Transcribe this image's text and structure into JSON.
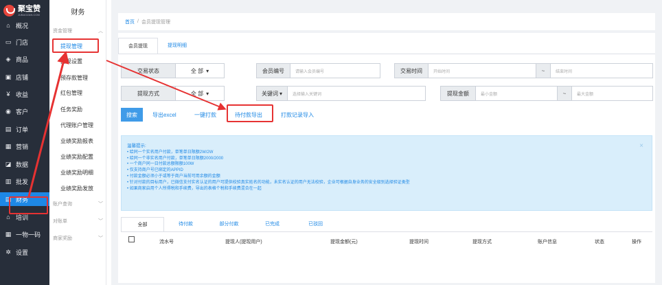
{
  "logo": {
    "name": "聚宝赞",
    "sub": "JUBAOZAN.COM"
  },
  "nav": [
    {
      "label": "概况",
      "icon": "home-icon"
    },
    {
      "label": "门店",
      "icon": "store-icon"
    },
    {
      "label": "商品",
      "icon": "tag-icon"
    },
    {
      "label": "店铺",
      "icon": "shop-icon"
    },
    {
      "label": "收益",
      "icon": "coin-icon"
    },
    {
      "label": "客户",
      "icon": "user-icon"
    },
    {
      "label": "订单",
      "icon": "order-icon"
    },
    {
      "label": "营销",
      "icon": "gift-icon"
    },
    {
      "label": "数据",
      "icon": "chart-icon"
    },
    {
      "label": "批发",
      "icon": "wholesale-icon"
    },
    {
      "label": "财务",
      "icon": "finance-icon",
      "active": true
    },
    {
      "label": "培训",
      "icon": "training-icon"
    },
    {
      "label": "一物一码",
      "icon": "qrcode-icon"
    },
    {
      "label": "设置",
      "icon": "settings-icon"
    }
  ],
  "submenu": {
    "title": "财务",
    "group_funds": "资金管理",
    "items": [
      "提现管理",
      "提现设置",
      "预存款管理",
      "红包管理",
      "任务奖励",
      "代理账户管理",
      "业绩奖励报表",
      "业绩奖励配置",
      "业绩奖励明细",
      "业绩奖励发放"
    ],
    "group_accounts": "账户查询",
    "group_reconcile": "对账单",
    "group_merchant": "商家奖励"
  },
  "breadcrumb": {
    "home": "首页",
    "sep": "/",
    "current": "会员提现管理"
  },
  "tabs": [
    "会员提现",
    "提现明细"
  ],
  "filters": {
    "trade_status_label": "交易状态",
    "trade_status_value": "全 部",
    "member_no_label": "会员编号",
    "member_no_placeholder": "请输入会员编号",
    "trade_time_label": "交易时间",
    "start_placeholder": "开始时间",
    "range_sep": "~",
    "end_placeholder": "结束时间",
    "method_label": "提现方式",
    "method_value": "全 部",
    "keyword_label": "关键词",
    "keyword_placeholder": "选择输入关键词",
    "amount_label": "提现金额",
    "min_placeholder": "最小金额",
    "max_placeholder": "最大金额"
  },
  "actions": {
    "search": "搜索",
    "export_excel": "导出excel",
    "one_click_pay": "一键打款",
    "pending_export": "待付款导出",
    "import_records": "打款记录导入"
  },
  "notice": {
    "title": "温馨提示:",
    "lines": [
      "• 给同一个实名用户付款，单笔单日限额2W/2W",
      "• 给同一个非实名用户付款，单笔单日限额2000/2000",
      "• 一个商户同一日付款总额限额100W",
      "• 仅支持商户号已绑定的APPID",
      "• 付款金额必须小于或等于商户当前可用余额的金额",
      "• 针对付款的目标用户，已微信支付实名认证的用户可提供校验真实姓名的功能，未实名认证的用户无法校验，企业可根据自身业务的安全级别选择验证类型",
      "• 如果商家启用个人所得税和手续费，导出的表格个税和手续费混合在一起"
    ]
  },
  "order_tabs": [
    "全部",
    "待付款",
    "部分付款",
    "已完成",
    "已驳回"
  ],
  "table_headers": [
    "流水号",
    "提现人(提现用户)",
    "提现金额(元)",
    "提现时间",
    "提现方式",
    "账户信息",
    "状态",
    "操作"
  ]
}
